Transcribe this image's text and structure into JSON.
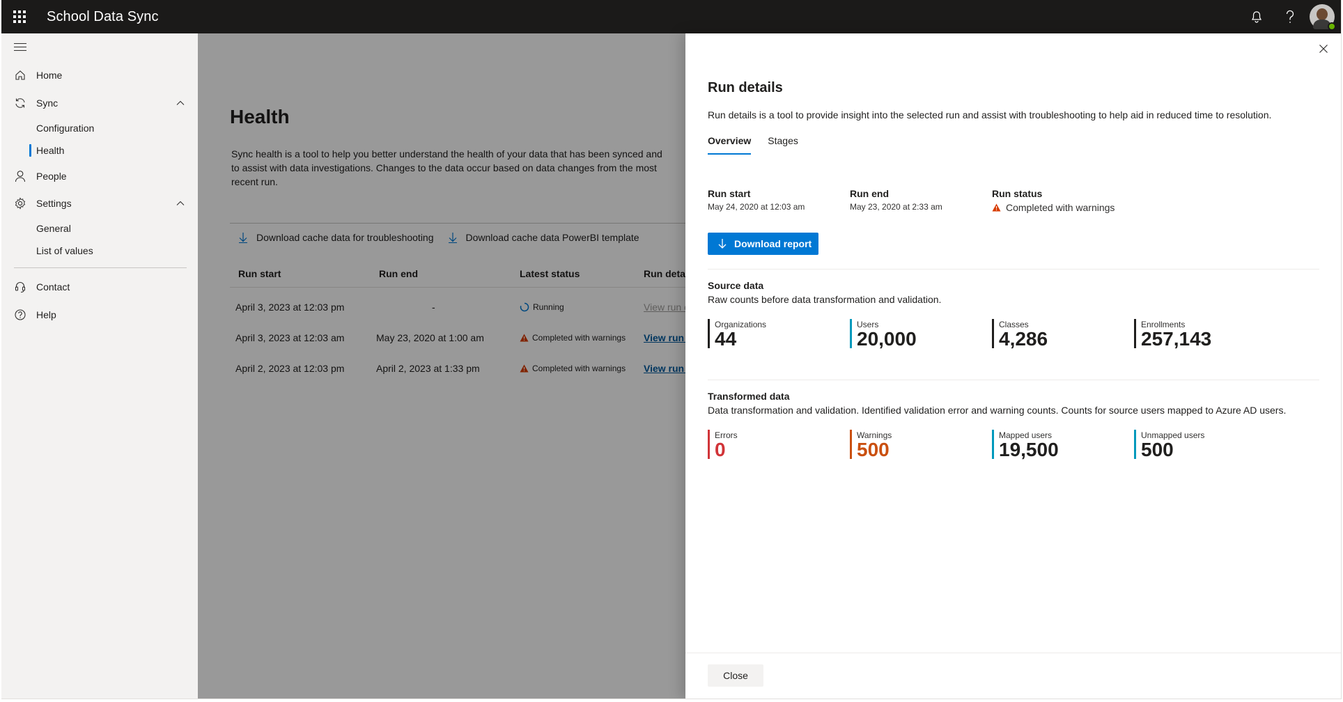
{
  "app": {
    "title": "School Data Sync"
  },
  "nav": {
    "items": [
      {
        "label": "Home",
        "icon": "home-icon"
      },
      {
        "label": "Sync",
        "icon": "sync-icon"
      },
      {
        "label": "People",
        "icon": "person-icon"
      },
      {
        "label": "Settings",
        "icon": "gear-icon"
      },
      {
        "label": "Contact",
        "icon": "headset-icon"
      },
      {
        "label": "Help",
        "icon": "help-circle-icon"
      }
    ],
    "sync_sub": [
      "Configuration",
      "Health"
    ],
    "settings_sub": [
      "General",
      "List of values"
    ],
    "active": "Health"
  },
  "main": {
    "title": "Health",
    "description": "Sync health is a tool to help you better understand the health of your data that has been synced and to assist with data investigations. Changes to the data occur based on data changes from the most recent run.",
    "commands": [
      "Download cache data for troubleshooting",
      "Download cache data PowerBI template"
    ],
    "table": {
      "headers": [
        "Run start",
        "Run end",
        "Latest status",
        "Run detail"
      ],
      "rows": [
        {
          "start": "April 3, 2023 at 12:03 pm",
          "end": "-",
          "status": "Running",
          "detail": "View run c"
        },
        {
          "start": "April 3, 2023 at 12:03 am",
          "end": "May 23, 2020 at 1:00 am",
          "status": "Completed with warnings",
          "detail": "View run c"
        },
        {
          "start": "April 2, 2023 at 12:03 pm",
          "end": "April 2, 2023 at 1:33 pm",
          "status": "Completed with warnings",
          "detail": "View run c"
        }
      ]
    }
  },
  "panel": {
    "title": "Run details",
    "description": "Run details is a tool to provide insight into the selected run and assist with troubleshooting to help aid in reduced time to resolution.",
    "tabs": [
      "Overview",
      "Stages"
    ],
    "active_tab": "Overview",
    "run_start": {
      "label": "Run start",
      "value": "May 24, 2020 at 12:03 am"
    },
    "run_end": {
      "label": "Run end",
      "value": "May 23, 2020 at 2:33 am"
    },
    "run_status": {
      "label": "Run status",
      "value": "Completed with warnings"
    },
    "download_label": "Download report",
    "source": {
      "title": "Source data",
      "description": "Raw counts before data transformation and validation.",
      "metrics": [
        {
          "label": "Organizations",
          "value": "44",
          "color": "#201f1e"
        },
        {
          "label": "Users",
          "value": "20,000",
          "color": "#0099bc"
        },
        {
          "label": "Classes",
          "value": "4,286",
          "color": "#201f1e"
        },
        {
          "label": "Enrollments",
          "value": "257,143",
          "color": "#201f1e"
        }
      ]
    },
    "transformed": {
      "title": "Transformed data",
      "description": "Data transformation and validation. Identified validation error and warning counts. Counts for source users mapped to Azure AD users.",
      "metrics": [
        {
          "label": "Errors",
          "value": "0",
          "color": "#d13438"
        },
        {
          "label": "Warnings",
          "value": "500",
          "color": "#ca5010"
        },
        {
          "label": "Mapped users",
          "value": "19,500",
          "color": "#0099bc"
        },
        {
          "label": "Unmapped users",
          "value": "500",
          "color": "#0099bc"
        }
      ]
    },
    "close_label": "Close"
  },
  "colors": {
    "accent": "#0078d4",
    "warning": "#d83b01",
    "error": "#d13438",
    "topbar": "#1b1a19"
  }
}
